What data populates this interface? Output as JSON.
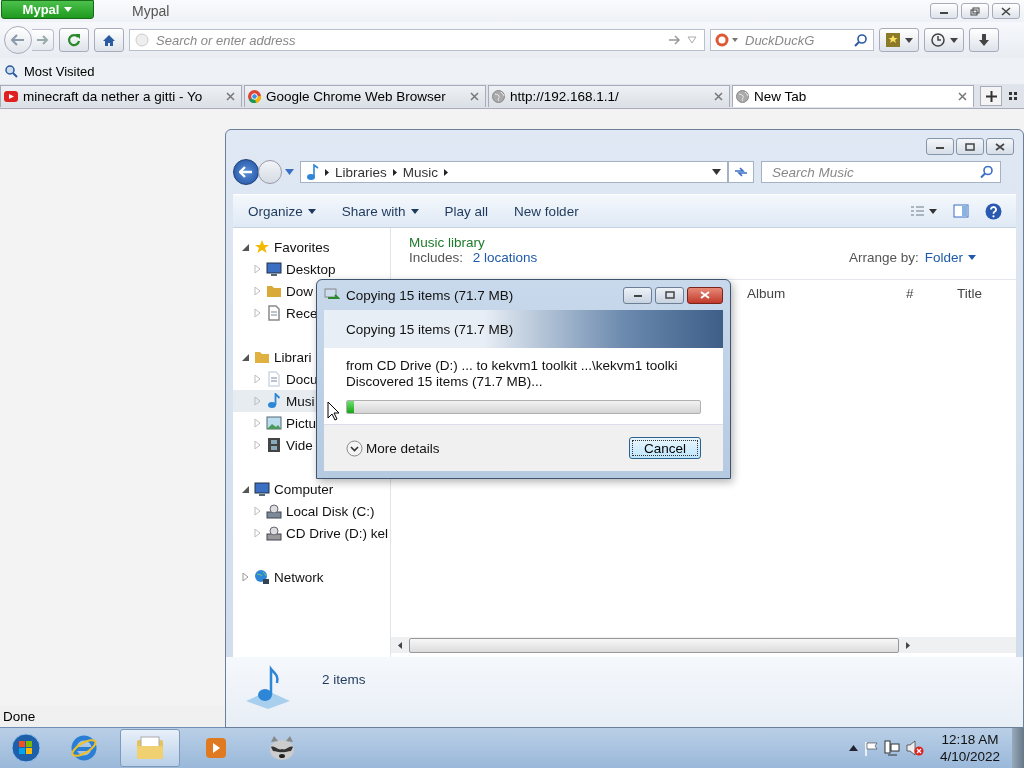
{
  "browser": {
    "app_button": "Mypal",
    "title": "Mypal",
    "address": {
      "placeholder": "Search or enter address"
    },
    "search": {
      "placeholder": "DuckDuckG"
    }
  },
  "bookmarks": [
    "Most Visited"
  ],
  "tabs": [
    {
      "label": "minecraft da nether a gitti - Yo",
      "kind": "video",
      "selected": false
    },
    {
      "label": "Google Chrome Web Browser",
      "kind": "chrome",
      "selected": false
    },
    {
      "label": "http://192.168.1.1/",
      "kind": "globe",
      "selected": false
    },
    {
      "label": "New Tab",
      "kind": "globe",
      "selected": true
    }
  ],
  "explorer": {
    "breadcrumb": [
      "Libraries",
      "Music"
    ],
    "search": {
      "placeholder": "Search Music"
    },
    "toolbar": [
      {
        "label": "Organize",
        "dropdown": true
      },
      {
        "label": "Share with",
        "dropdown": true
      },
      {
        "label": "Play all",
        "dropdown": false
      },
      {
        "label": "New folder",
        "dropdown": false
      }
    ],
    "library_title": "Music library",
    "includes_label": "Includes:",
    "includes_link": "2 locations",
    "arrange_label": "Arrange by:",
    "arrange_value": "Folder",
    "columns": [
      "Album",
      "#",
      "Title"
    ],
    "tree": [
      {
        "label": "Favorites",
        "kind": "star",
        "expanded": true,
        "selected": false,
        "children": [
          {
            "label": "Desktop",
            "kind": "desktop",
            "selected": false
          },
          {
            "label": "Dow",
            "kind": "folder",
            "selected": false
          },
          {
            "label": "Rece",
            "kind": "recent",
            "selected": false
          }
        ]
      },
      {
        "label": "Librari",
        "kind": "library",
        "expanded": true,
        "selected": false,
        "children": [
          {
            "label": "Docu",
            "kind": "document",
            "selected": false
          },
          {
            "label": "Musi",
            "kind": "music",
            "selected": true
          },
          {
            "label": "Pictu",
            "kind": "picture",
            "selected": false
          },
          {
            "label": "Vide",
            "kind": "video",
            "selected": false
          }
        ]
      },
      {
        "label": "Computer",
        "kind": "computer",
        "expanded": true,
        "selected": false,
        "children": [
          {
            "label": "Local Disk (C:)",
            "kind": "disk",
            "selected": false
          },
          {
            "label": "CD Drive (D:) kel",
            "kind": "cd",
            "selected": false
          }
        ]
      },
      {
        "label": "Network",
        "kind": "network",
        "expanded": false,
        "selected": false
      }
    ],
    "status": "2 items"
  },
  "dialog": {
    "title": "Copying 15 items (71.7 MB)",
    "heading": "Copying 15 items (71.7 MB)",
    "from_line": "from CD Drive (D:) ...  to kekvm1 toolkit ...\\kekvm1 toolki",
    "progress_text": "Discovered 15 items (71.7 MB)...",
    "level": 0.02,
    "more_details": "More details",
    "cancel": "Cancel"
  },
  "status_bar": "Done",
  "taskbar": {
    "apps": [
      {
        "kind": "ie",
        "selected": false
      },
      {
        "kind": "explorer",
        "selected": true
      },
      {
        "kind": "media",
        "selected": false
      },
      {
        "kind": "raccoon",
        "selected": false
      }
    ],
    "time": "12:18 AM",
    "date": "4/10/2022"
  }
}
